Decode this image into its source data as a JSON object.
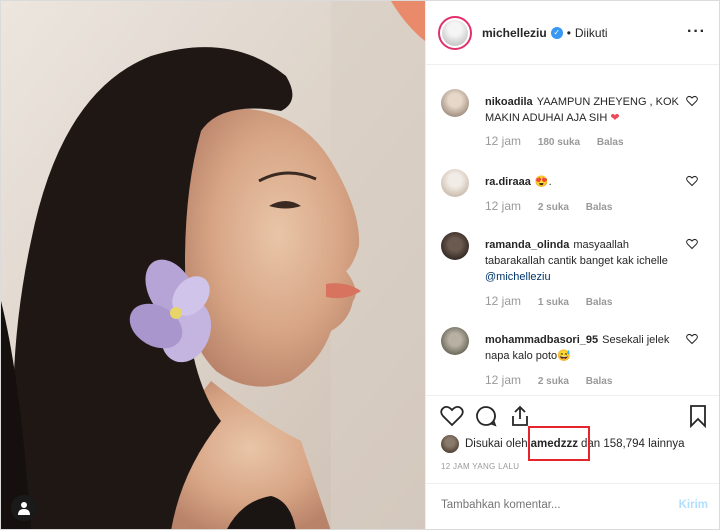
{
  "post": {
    "username": "michelleziu",
    "follow_status": "Diikuti",
    "separator": "•",
    "more_icon": "more-horizontal-icon"
  },
  "comments": [
    {
      "username": "nikoadila",
      "text": "YAAMPUN ZHEYENG , KOK MAKIN ADUHAI AJA SIH",
      "emoji": "❤",
      "time": "12 jam",
      "likes": "180 suka",
      "reply": "Balas"
    },
    {
      "username": "ra.diraaa",
      "text": "😍.",
      "time": "12 jam",
      "likes": "2 suka",
      "reply": "Balas"
    },
    {
      "username": "ramanda_olinda",
      "text": "masyaallah tabarakallah cantik banget kak ichelle",
      "mention": "@michelleziu",
      "time": "12 jam",
      "likes": "1 suka",
      "reply": "Balas"
    },
    {
      "username": "mohammadbasori_95",
      "text": "Sesekali jelek napa kalo poto😅",
      "time": "12 jam",
      "likes": "2 suka",
      "reply": "Balas"
    }
  ],
  "likes_line": {
    "prefix": "Disukai oleh",
    "user": "amedzzz",
    "middle": "dan",
    "count": "158,794",
    "suffix": "lainnya"
  },
  "post_time": "12 JAM YANG LALU",
  "add_comment": {
    "placeholder": "Tambahkan komentar...",
    "post_label": "Kirim"
  },
  "colors": {
    "accent": "#3897f0",
    "highlight_box": "#e4252b",
    "heart_red": "#ed4956"
  }
}
